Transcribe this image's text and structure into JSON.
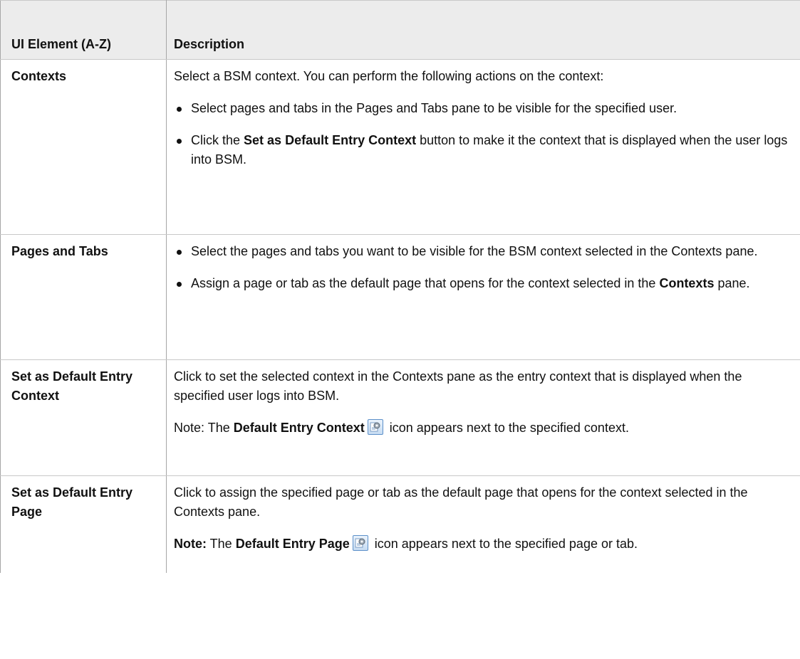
{
  "table": {
    "headers": {
      "element": "UI Element (A-Z)",
      "description": "Description"
    },
    "rows": [
      {
        "name": "Contexts",
        "intro": "Select a BSM context. You can perform the following actions on the context:",
        "bullets": [
          {
            "text": "Select pages and tabs in the Pages and Tabs pane to be visible for the specified user."
          },
          {
            "before": "Click the ",
            "bold": "Set as Default Entry Context",
            "after": " button to make it the context that is displayed when the user logs into BSM."
          }
        ]
      },
      {
        "name": "Pages and Tabs",
        "bullets": [
          {
            "text": "Select the pages and tabs you want to be visible for the BSM context selected in the Contexts pane."
          },
          {
            "before": "Assign a page or tab as the default page that opens for the context selected in the ",
            "bold": "Contexts",
            "after": " pane."
          }
        ]
      },
      {
        "name": "Set as Default Entry Context",
        "para1": "Click to set the selected context in the Contexts pane as the entry context that is displayed when the specified user logs into BSM.",
        "note": {
          "prefix": "Note: The ",
          "bold": "Default Entry Context",
          "icon": "default-entry-icon",
          "suffix": " icon appears next to the specified context."
        }
      },
      {
        "name": "Set as Default Entry Page",
        "para1": "Click to assign the specified page or tab as the default page that opens for the context selected in the Contexts pane.",
        "note": {
          "label": "Note:",
          "prefix": " The ",
          "bold": "Default Entry Page",
          "icon": "default-entry-icon",
          "suffix": " icon appears next to the specified page or tab."
        }
      }
    ]
  }
}
